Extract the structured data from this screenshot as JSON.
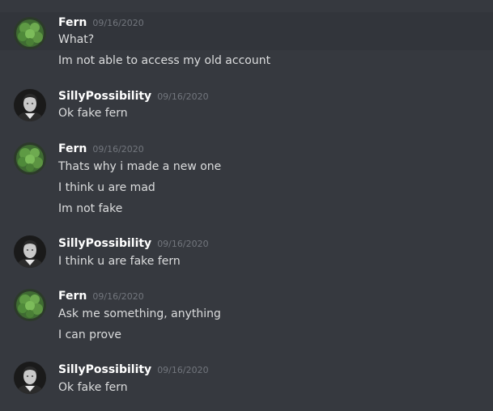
{
  "messages": [
    {
      "author": "Fern",
      "timestamp": "09/16/2020",
      "avatar": "fern-plant-icon",
      "lines": [
        "What?",
        "Im not able to access my old account"
      ]
    },
    {
      "author": "SillyPossibility",
      "timestamp": "09/16/2020",
      "avatar": "portrait-icon",
      "lines": [
        "Ok fake fern"
      ]
    },
    {
      "author": "Fern",
      "timestamp": "09/16/2020",
      "avatar": "fern-plant-icon",
      "lines": [
        "Thats why i made a new one",
        "I think u are mad",
        "Im not fake"
      ]
    },
    {
      "author": "SillyPossibility",
      "timestamp": "09/16/2020",
      "avatar": "portrait-icon",
      "lines": [
        "I think u are fake fern"
      ]
    },
    {
      "author": "Fern",
      "timestamp": "09/16/2020",
      "avatar": "fern-plant-icon",
      "lines": [
        "Ask me something, anything",
        "I can prove"
      ]
    },
    {
      "author": "SillyPossibility",
      "timestamp": "09/16/2020",
      "avatar": "portrait-icon",
      "lines": [
        "Ok fake fern"
      ]
    }
  ],
  "colors": {
    "background": "#36393f",
    "highlight": "#32353b",
    "author": "#ffffff",
    "timestamp": "#72767d",
    "text": "#dcddde"
  }
}
